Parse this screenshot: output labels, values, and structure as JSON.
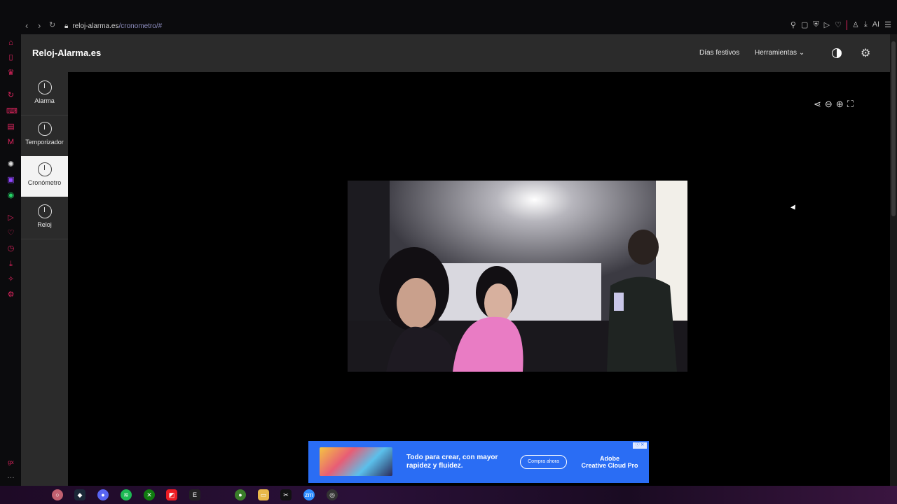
{
  "browser": {
    "url_domain": "reloj-alarma.es",
    "url_path": "/cronometro/#",
    "ai_label": "AI"
  },
  "site": {
    "brand": "Reloj-Alarma.es",
    "nav": {
      "holidays": "Días festivos",
      "tools": "Herramientas"
    }
  },
  "sidebar": {
    "items": [
      {
        "label": "Alarma",
        "icon": "alarm-clock-icon"
      },
      {
        "label": "Temporizador",
        "icon": "timer-icon"
      },
      {
        "label": "Cronómetro",
        "icon": "stopwatch-icon",
        "active": true
      },
      {
        "label": "Reloj",
        "icon": "clock-icon"
      }
    ]
  },
  "tools": [
    "share-icon",
    "zoom-out-icon",
    "zoom-in-icon",
    "fullscreen-icon"
  ],
  "ad": {
    "headline": "Todo para crear, con mayor rapidez y fluidez.",
    "button": "Compra ahora",
    "brand_line1": "Adobe",
    "brand_line2": "Creative Cloud Pro"
  },
  "colors": {
    "accent": "#e0245e",
    "header_bg": "#2b2b2b",
    "ad_bg": "#2a6df4"
  }
}
